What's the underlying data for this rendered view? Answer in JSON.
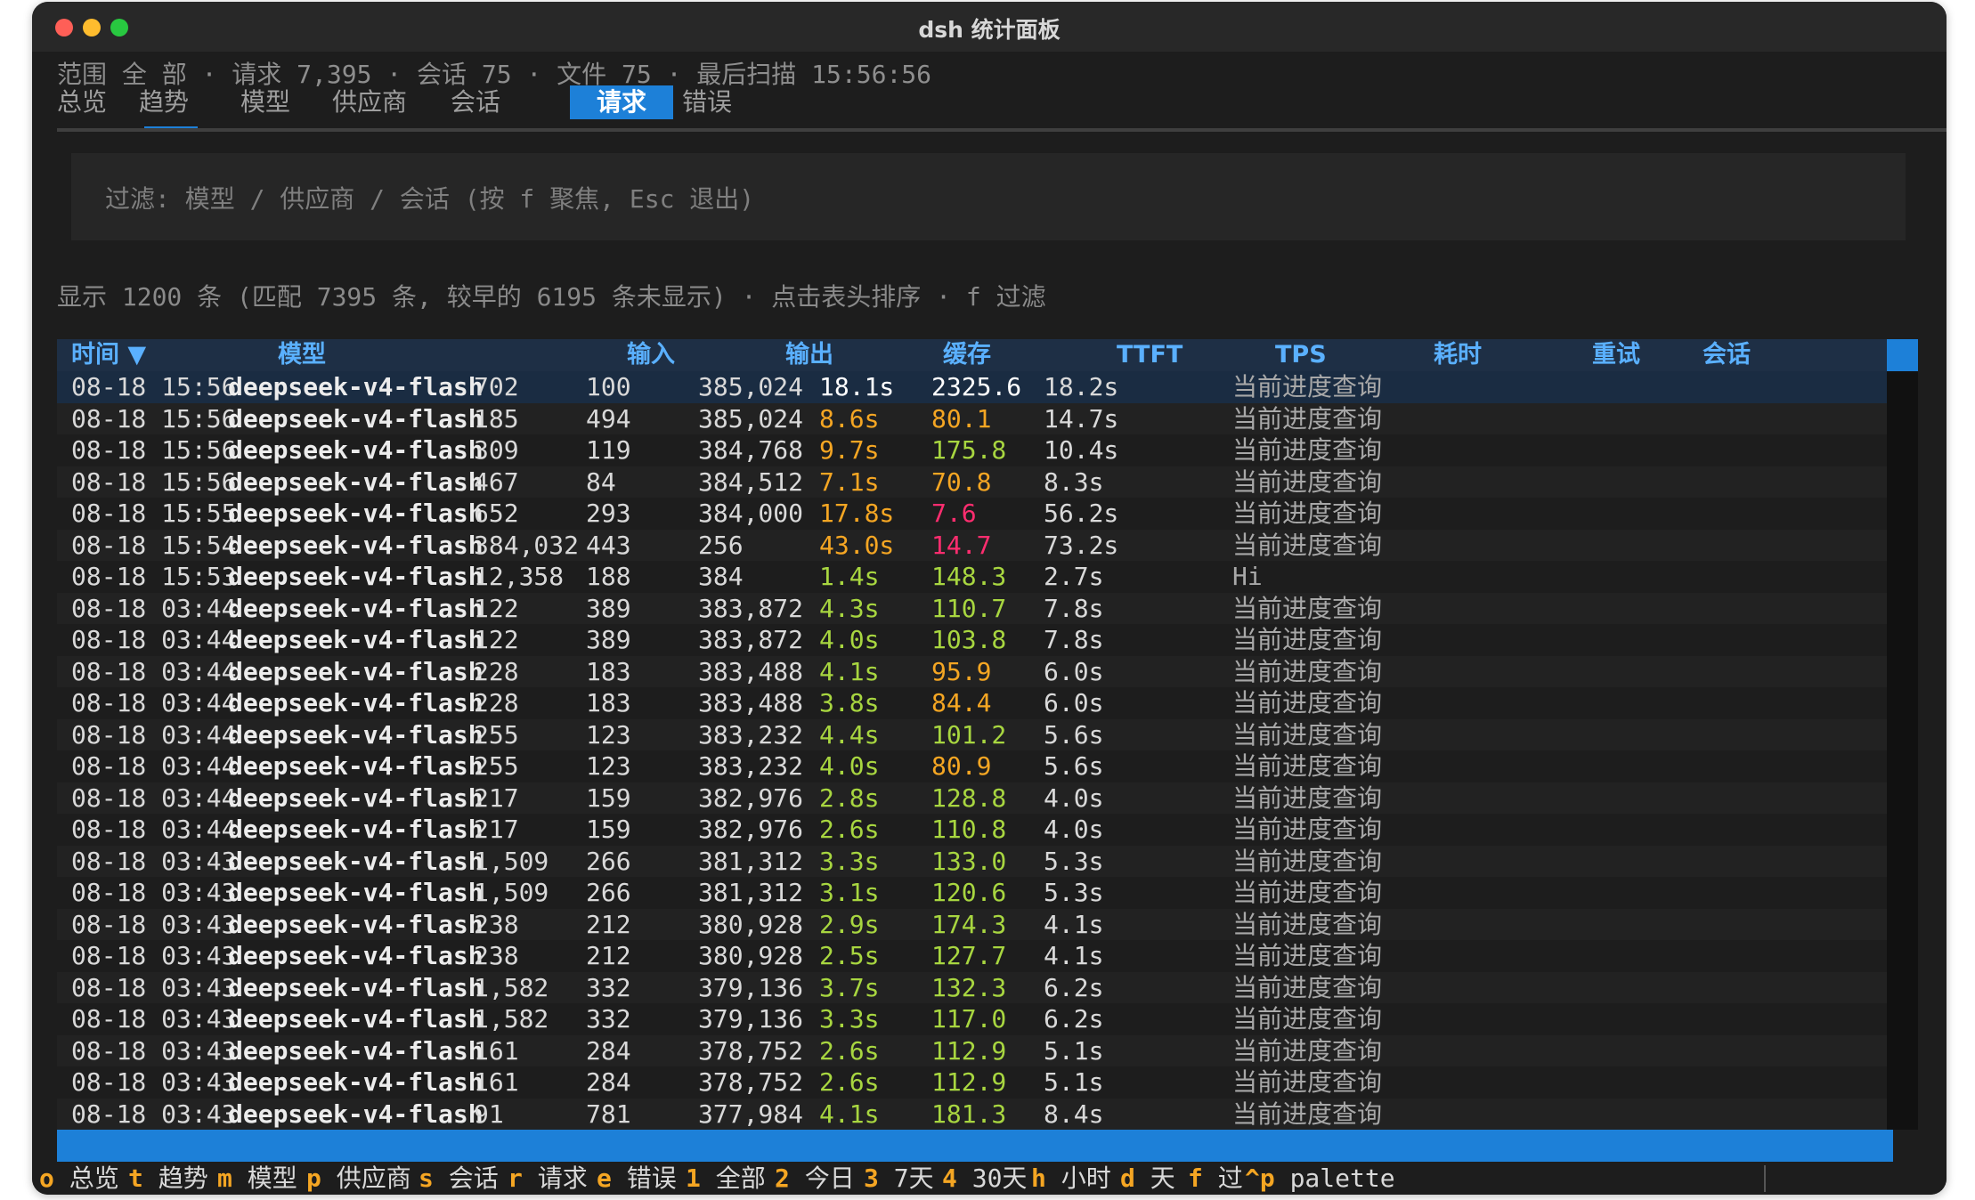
{
  "window": {
    "title": "dsh 统计面板"
  },
  "summary": "范围 全 部 · 请求 7,395 · 会话 75 · 文件 75 · 最后扫描 15:56:56",
  "tabs": [
    "总览",
    "趋势",
    "模型",
    "供应商",
    "会话",
    "请求",
    "错误"
  ],
  "active_tab": "请求",
  "filter": {
    "placeholder": "过滤: 模型 / 供应商 / 会话 (按 f 聚焦, Esc 退出)"
  },
  "info": "显示 1200 条 (匹配 7395 条, 较早的 6195 条未显示) · 点击表头排序 · f 过滤",
  "table": {
    "headers": [
      "时间 ▼",
      "模型",
      "输入",
      "输出",
      "缓存",
      "TTFT",
      "TPS",
      "耗时",
      "重试",
      "会话"
    ],
    "rows": [
      {
        "time": "08-18 15:56",
        "model": "deepseek-v4-flash",
        "input": "702",
        "output": "100",
        "cache": "385,024",
        "ttft": "18.1s",
        "ttft_color": "#ffffff",
        "tps": "2325.6",
        "tps_color": "#ffffff",
        "dur": "18.2s",
        "retry": "",
        "session": "当前进度查询"
      },
      {
        "time": "08-18 15:56",
        "model": "deepseek-v4-flash",
        "input": "185",
        "output": "494",
        "cache": "385,024",
        "ttft": "8.6s",
        "ttft_color": "#f5a623",
        "tps": "80.1",
        "tps_color": "#f5a623",
        "dur": "14.7s",
        "retry": "",
        "session": "当前进度查询"
      },
      {
        "time": "08-18 15:56",
        "model": "deepseek-v4-flash",
        "input": "309",
        "output": "119",
        "cache": "384,768",
        "ttft": "9.7s",
        "ttft_color": "#f5a623",
        "tps": "175.8",
        "tps_color": "#a8d640",
        "dur": "10.4s",
        "retry": "",
        "session": "当前进度查询"
      },
      {
        "time": "08-18 15:56",
        "model": "deepseek-v4-flash",
        "input": "467",
        "output": "84",
        "cache": "384,512",
        "ttft": "7.1s",
        "ttft_color": "#f5a623",
        "tps": "70.8",
        "tps_color": "#f5a623",
        "dur": "8.3s",
        "retry": "",
        "session": "当前进度查询"
      },
      {
        "time": "08-18 15:55",
        "model": "deepseek-v4-flash",
        "input": "652",
        "output": "293",
        "cache": "384,000",
        "ttft": "17.8s",
        "ttft_color": "#f5a623",
        "tps": "7.6",
        "tps_color": "#ff2d6f",
        "dur": "56.2s",
        "retry": "",
        "session": "当前进度查询"
      },
      {
        "time": "08-18 15:54",
        "model": "deepseek-v4-flash",
        "input": "384,032",
        "output": "443",
        "cache": "256",
        "ttft": "43.0s",
        "ttft_color": "#f5a623",
        "tps": "14.7",
        "tps_color": "#ff2d6f",
        "dur": "73.2s",
        "retry": "",
        "session": "当前进度查询"
      },
      {
        "time": "08-18 15:53",
        "model": "deepseek-v4-flash",
        "input": "12,358",
        "output": "188",
        "cache": "384",
        "ttft": "1.4s",
        "ttft_color": "#a8d640",
        "tps": "148.3",
        "tps_color": "#a8d640",
        "dur": "2.7s",
        "retry": "",
        "session": "Hi"
      },
      {
        "time": "08-18 03:44",
        "model": "deepseek-v4-flash",
        "input": "122",
        "output": "389",
        "cache": "383,872",
        "ttft": "4.3s",
        "ttft_color": "#a8d640",
        "tps": "110.7",
        "tps_color": "#a8d640",
        "dur": "7.8s",
        "retry": "",
        "session": "当前进度查询"
      },
      {
        "time": "08-18 03:44",
        "model": "deepseek-v4-flash",
        "input": "122",
        "output": "389",
        "cache": "383,872",
        "ttft": "4.0s",
        "ttft_color": "#a8d640",
        "tps": "103.8",
        "tps_color": "#a8d640",
        "dur": "7.8s",
        "retry": "",
        "session": "当前进度查询"
      },
      {
        "time": "08-18 03:44",
        "model": "deepseek-v4-flash",
        "input": "228",
        "output": "183",
        "cache": "383,488",
        "ttft": "4.1s",
        "ttft_color": "#a8d640",
        "tps": "95.9",
        "tps_color": "#f5a623",
        "dur": "6.0s",
        "retry": "",
        "session": "当前进度查询"
      },
      {
        "time": "08-18 03:44",
        "model": "deepseek-v4-flash",
        "input": "228",
        "output": "183",
        "cache": "383,488",
        "ttft": "3.8s",
        "ttft_color": "#a8d640",
        "tps": "84.4",
        "tps_color": "#f5a623",
        "dur": "6.0s",
        "retry": "",
        "session": "当前进度查询"
      },
      {
        "time": "08-18 03:44",
        "model": "deepseek-v4-flash",
        "input": "255",
        "output": "123",
        "cache": "383,232",
        "ttft": "4.4s",
        "ttft_color": "#a8d640",
        "tps": "101.2",
        "tps_color": "#a8d640",
        "dur": "5.6s",
        "retry": "",
        "session": "当前进度查询"
      },
      {
        "time": "08-18 03:44",
        "model": "deepseek-v4-flash",
        "input": "255",
        "output": "123",
        "cache": "383,232",
        "ttft": "4.0s",
        "ttft_color": "#a8d640",
        "tps": "80.9",
        "tps_color": "#f5a623",
        "dur": "5.6s",
        "retry": "",
        "session": "当前进度查询"
      },
      {
        "time": "08-18 03:44",
        "model": "deepseek-v4-flash",
        "input": "217",
        "output": "159",
        "cache": "382,976",
        "ttft": "2.8s",
        "ttft_color": "#a8d640",
        "tps": "128.8",
        "tps_color": "#a8d640",
        "dur": "4.0s",
        "retry": "",
        "session": "当前进度查询"
      },
      {
        "time": "08-18 03:44",
        "model": "deepseek-v4-flash",
        "input": "217",
        "output": "159",
        "cache": "382,976",
        "ttft": "2.6s",
        "ttft_color": "#a8d640",
        "tps": "110.8",
        "tps_color": "#a8d640",
        "dur": "4.0s",
        "retry": "",
        "session": "当前进度查询"
      },
      {
        "time": "08-18 03:43",
        "model": "deepseek-v4-flash",
        "input": "1,509",
        "output": "266",
        "cache": "381,312",
        "ttft": "3.3s",
        "ttft_color": "#a8d640",
        "tps": "133.0",
        "tps_color": "#a8d640",
        "dur": "5.3s",
        "retry": "",
        "session": "当前进度查询"
      },
      {
        "time": "08-18 03:43",
        "model": "deepseek-v4-flash",
        "input": "1,509",
        "output": "266",
        "cache": "381,312",
        "ttft": "3.1s",
        "ttft_color": "#a8d640",
        "tps": "120.6",
        "tps_color": "#a8d640",
        "dur": "5.3s",
        "retry": "",
        "session": "当前进度查询"
      },
      {
        "time": "08-18 03:43",
        "model": "deepseek-v4-flash",
        "input": "238",
        "output": "212",
        "cache": "380,928",
        "ttft": "2.9s",
        "ttft_color": "#a8d640",
        "tps": "174.3",
        "tps_color": "#a8d640",
        "dur": "4.1s",
        "retry": "",
        "session": "当前进度查询"
      },
      {
        "time": "08-18 03:43",
        "model": "deepseek-v4-flash",
        "input": "238",
        "output": "212",
        "cache": "380,928",
        "ttft": "2.5s",
        "ttft_color": "#a8d640",
        "tps": "127.7",
        "tps_color": "#a8d640",
        "dur": "4.1s",
        "retry": "",
        "session": "当前进度查询"
      },
      {
        "time": "08-18 03:43",
        "model": "deepseek-v4-flash",
        "input": "1,582",
        "output": "332",
        "cache": "379,136",
        "ttft": "3.7s",
        "ttft_color": "#a8d640",
        "tps": "132.3",
        "tps_color": "#a8d640",
        "dur": "6.2s",
        "retry": "",
        "session": "当前进度查询"
      },
      {
        "time": "08-18 03:43",
        "model": "deepseek-v4-flash",
        "input": "1,582",
        "output": "332",
        "cache": "379,136",
        "ttft": "3.3s",
        "ttft_color": "#a8d640",
        "tps": "117.0",
        "tps_color": "#a8d640",
        "dur": "6.2s",
        "retry": "",
        "session": "当前进度查询"
      },
      {
        "time": "08-18 03:43",
        "model": "deepseek-v4-flash",
        "input": "161",
        "output": "284",
        "cache": "378,752",
        "ttft": "2.6s",
        "ttft_color": "#a8d640",
        "tps": "112.9",
        "tps_color": "#a8d640",
        "dur": "5.1s",
        "retry": "",
        "session": "当前进度查询"
      },
      {
        "time": "08-18 03:43",
        "model": "deepseek-v4-flash",
        "input": "161",
        "output": "284",
        "cache": "378,752",
        "ttft": "2.6s",
        "ttft_color": "#a8d640",
        "tps": "112.9",
        "tps_color": "#a8d640",
        "dur": "5.1s",
        "retry": "",
        "session": "当前进度查询"
      },
      {
        "time": "08-18 03:43",
        "model": "deepseek-v4-flash",
        "input": "91",
        "output": "781",
        "cache": "377,984",
        "ttft": "4.1s",
        "ttft_color": "#a8d640",
        "tps": "181.3",
        "tps_color": "#a8d640",
        "dur": "8.4s",
        "retry": "",
        "session": "当前进度查询"
      }
    ]
  },
  "footer": [
    {
      "key": "o",
      "label": "总览"
    },
    {
      "key": "t",
      "label": "趋势"
    },
    {
      "key": "m",
      "label": "模型"
    },
    {
      "key": "p",
      "label": "供应商"
    },
    {
      "key": "s",
      "label": "会话"
    },
    {
      "key": "r",
      "label": "请求"
    },
    {
      "key": "e",
      "label": "错误"
    },
    {
      "key": "1",
      "label": "全部"
    },
    {
      "key": "2",
      "label": "今日"
    },
    {
      "key": "3",
      "label": "7天"
    },
    {
      "key": "4",
      "label": "30天"
    },
    {
      "key": "h",
      "label": "小时"
    },
    {
      "key": "d",
      "label": "天"
    },
    {
      "key": "f",
      "label": "过"
    },
    {
      "key": "^p",
      "label": "palette"
    }
  ],
  "colors": {
    "accent": "#1d80d8",
    "header_text": "#5ab0ff",
    "good": "#a8d640",
    "warn": "#f5a623",
    "bad": "#ff2d6f",
    "hotkey": "#f5a623"
  }
}
